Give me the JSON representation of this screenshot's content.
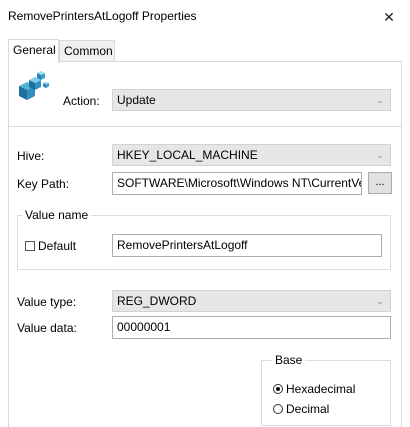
{
  "window": {
    "title": "RemovePrintersAtLogoff Properties",
    "close_glyph": "✕"
  },
  "tabs": [
    {
      "label": "General",
      "active": true
    },
    {
      "label": "Common",
      "active": false
    }
  ],
  "action": {
    "label": "Action:",
    "value": "Update"
  },
  "hive": {
    "label": "Hive:",
    "value": "HKEY_LOCAL_MACHINE"
  },
  "key_path": {
    "label": "Key Path:",
    "value": "SOFTWARE\\Microsoft\\Windows NT\\CurrentVersion\\Winlogon",
    "browse_label": "..."
  },
  "value_name": {
    "group_label": "Value name",
    "default_label": "Default",
    "default_checked": false,
    "value": "RemovePrintersAtLogoff"
  },
  "value_type": {
    "label": "Value type:",
    "value": "REG_DWORD"
  },
  "value_data": {
    "label": "Value data:",
    "value": "00000001"
  },
  "base": {
    "group_label": "Base",
    "options": [
      {
        "label": "Hexadecimal",
        "selected": true
      },
      {
        "label": "Decimal",
        "selected": false
      }
    ]
  },
  "icons": {
    "registry": "registry-cubes-icon",
    "dropdown": "chevron-down-icon",
    "close": "close-icon"
  }
}
